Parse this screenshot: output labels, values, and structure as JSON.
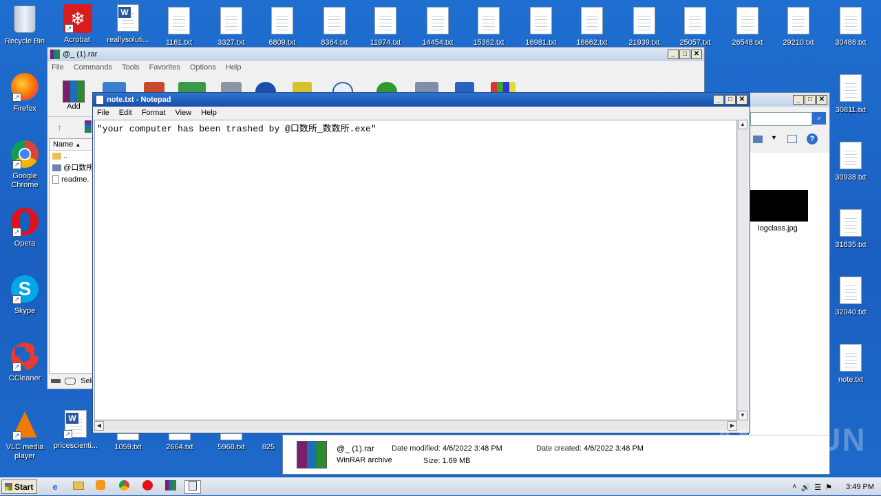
{
  "desktop": {
    "left_icons": [
      {
        "label": "Recycle Bin",
        "icon": "recycle-bin-icon"
      },
      {
        "label": "Acrobat",
        "icon": "acrobat-icon"
      },
      {
        "label": "reallysoluti...",
        "icon": "word-doc-icon"
      },
      {
        "label": "Firefox",
        "icon": "firefox-icon"
      },
      {
        "label": "Google Chrome",
        "icon": "chrome-icon"
      },
      {
        "label": "Opera",
        "icon": "opera-icon"
      },
      {
        "label": "Skype",
        "icon": "skype-icon"
      },
      {
        "label": "CCleaner",
        "icon": "ccleaner-icon"
      },
      {
        "label": "VLC media player",
        "icon": "vlc-icon"
      },
      {
        "label": "pricescienti...",
        "icon": "word-doc-icon"
      }
    ],
    "top_files": [
      "1161.txt",
      "3327.txt",
      "6809.txt",
      "8364.txt",
      "11974.txt",
      "14454.txt",
      "15362.txt",
      "16981.txt",
      "18662.txt",
      "21939.txt",
      "25057.txt",
      "26548.txt",
      "29210.txt",
      "30486.txt"
    ],
    "right_files": [
      "30811.txt",
      "30938.txt",
      "31635.txt",
      "32040.txt",
      "note.txt"
    ],
    "bottom_files": [
      "1059.txt",
      "2664.txt",
      "5968.txt",
      "825"
    ]
  },
  "winrar": {
    "title": "@_ (1).rar",
    "menu": [
      "File",
      "Commands",
      "Tools",
      "Favorites",
      "Options",
      "Help"
    ],
    "add_label": "Add",
    "column_name": "Name",
    "rows": [
      "..",
      "@口数所",
      "readme."
    ],
    "status": "Sele"
  },
  "explorer": {
    "preview_file": "logclass.jpg",
    "details": {
      "filename": "@_ (1).rar",
      "filetype": "WinRAR archive",
      "modified_label": "Date modified:",
      "modified_value": "4/6/2022 3:48 PM",
      "size_label": "Size:",
      "size_value": "1.69 MB",
      "created_label": "Date created:",
      "created_value": "4/6/2022 3:48 PM"
    }
  },
  "notepad": {
    "title": "note.txt - Notepad",
    "menu": [
      "File",
      "Edit",
      "Format",
      "View",
      "Help"
    ],
    "content": "\"your computer has been trashed by @口数所_数数所.exe\""
  },
  "taskbar": {
    "start_label": "Start",
    "clock": "3:49 PM"
  },
  "watermark": "ANY RUN"
}
